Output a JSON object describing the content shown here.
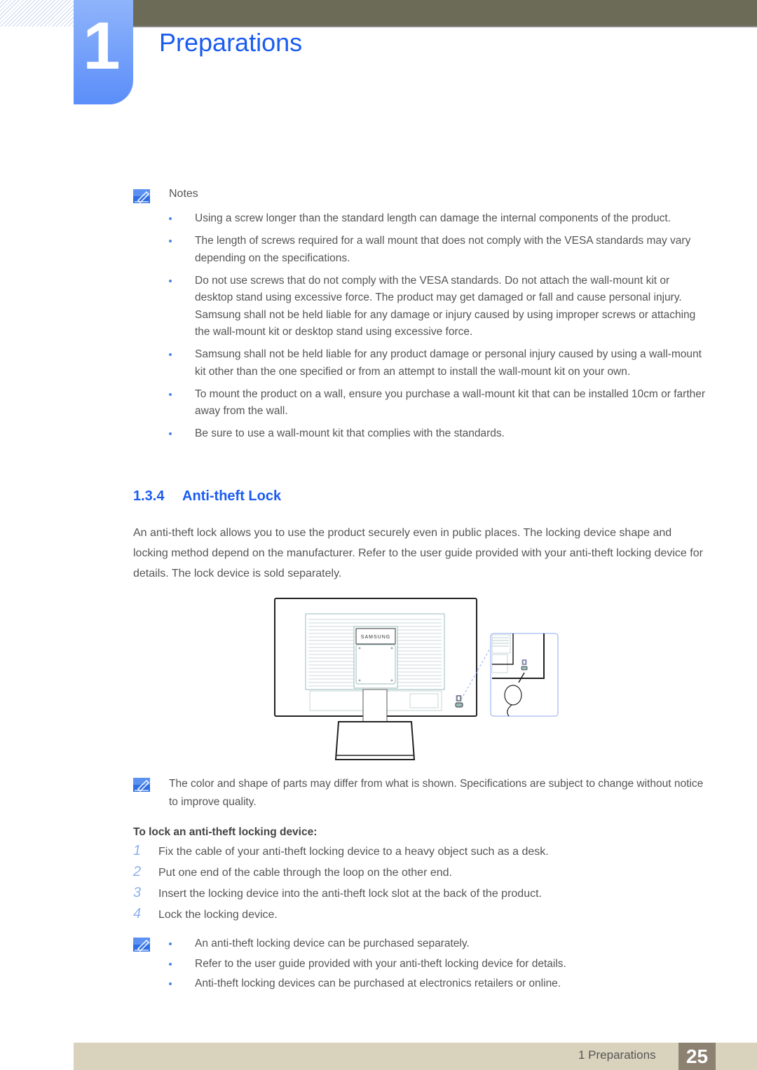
{
  "header": {
    "chapter_number": "1",
    "chapter_title": "Preparations"
  },
  "notes": {
    "label": "Notes",
    "items": [
      "Using a screw longer than the standard length can damage the internal components of the product.",
      "The length of screws required for a wall mount that does not comply with the VESA standards may vary depending on the specifications.",
      "Do not use screws that do not comply with the VESA standards. Do not attach the wall-mount kit or desktop stand using excessive force. The product may get damaged or fall and cause personal injury. Samsung shall not be held liable for any damage or injury caused by using improper screws or attaching the wall-mount kit or desktop stand using excessive force.",
      "Samsung shall not be held liable for any product damage or personal injury caused by using a wall-mount kit other than the one specified or from an attempt to install the wall-mount kit on your own.",
      "To mount the product on a wall, ensure you purchase a wall-mount kit that can be installed 10cm or farther away from the wall.",
      "Be sure to use a wall-mount kit that complies with the standards."
    ]
  },
  "section": {
    "number": "1.3.4",
    "title": "Anti-theft Lock",
    "body": "An anti-theft lock allows you to use the product securely even in public places. The locking device shape and locking method depend on the manufacturer. Refer to the user guide provided with your anti-theft locking device for details. The lock device is sold separately."
  },
  "figure": {
    "brand_label": "SAMSUNG"
  },
  "caption_note": "The color and shape of parts may differ from what is shown. Specifications are subject to change without notice to improve quality.",
  "steps": {
    "title": "To lock an anti-theft locking device:",
    "items": [
      {
        "num": "1",
        "text": "Fix the cable of your anti-theft locking device to a heavy object such as a desk."
      },
      {
        "num": "2",
        "text": "Put one end of the cable through the loop on the other end."
      },
      {
        "num": "3",
        "text": "Insert the locking device into the anti-theft lock slot at the back of the product."
      },
      {
        "num": "4",
        "text": "Lock the locking device."
      }
    ]
  },
  "final_notes": [
    "An anti-theft locking device can be purchased separately.",
    "Refer to the user guide provided with your anti-theft locking device for details.",
    "Anti-theft locking devices can be purchased at electronics retailers or online."
  ],
  "footer": {
    "label": "1 Preparations",
    "page": "25"
  },
  "colors": {
    "accent_blue": "#1a5cf0",
    "header_bar": "#6c6b58",
    "footer_bar": "#d9d3bd",
    "page_box": "#8d8172"
  }
}
